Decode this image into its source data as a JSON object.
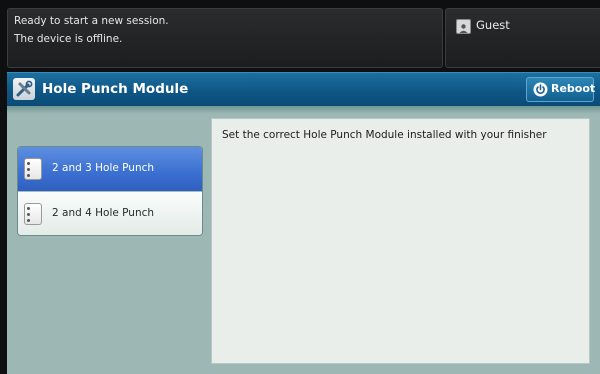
{
  "status": {
    "line1": "Ready to start a new session.",
    "line2": "The device is offline."
  },
  "user": {
    "label": "Guest",
    "icon": "user-icon"
  },
  "titlebar": {
    "title": "Hole Punch Module",
    "icon": "tools-icon",
    "reboot_label": "Reboot",
    "reboot_icon": "power-icon"
  },
  "options": [
    {
      "label": "2 and 3 Hole Punch",
      "selected": true,
      "icon": "hole-punch-page-icon"
    },
    {
      "label": "2 and 4 Hole Punch",
      "selected": false,
      "icon": "hole-punch-page-icon"
    }
  ],
  "info": {
    "text": "Set the correct Hole Punch Module installed with your finisher"
  },
  "colors": {
    "titlebar": "#0f5685",
    "selected_option": "#3b6fd0",
    "body_background": "#9db8b4"
  }
}
